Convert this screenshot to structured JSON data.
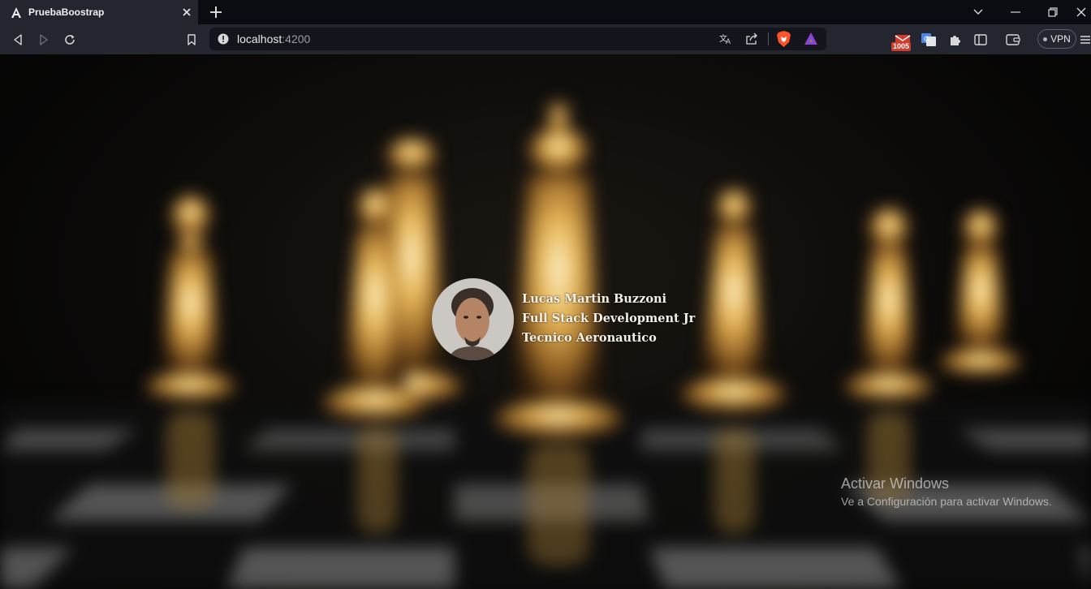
{
  "browser": {
    "tab_title": "PruebaBoostrap",
    "url_host": "localhost",
    "url_port": ":4200",
    "extension_badge": "1005",
    "vpn_label": "VPN"
  },
  "profile": {
    "name": "Lucas Martin Buzzoni",
    "role": "Full Stack Development Jr",
    "title": "Tecnico Aeronautico"
  },
  "windows_activation": {
    "title": "Activar Windows",
    "subtitle": "Ve a Configuración para activar Windows."
  },
  "colors": {
    "chrome_bg": "#23252f",
    "tabbar_bg": "#0b0c12",
    "accent_gold": "#d8a94a"
  }
}
